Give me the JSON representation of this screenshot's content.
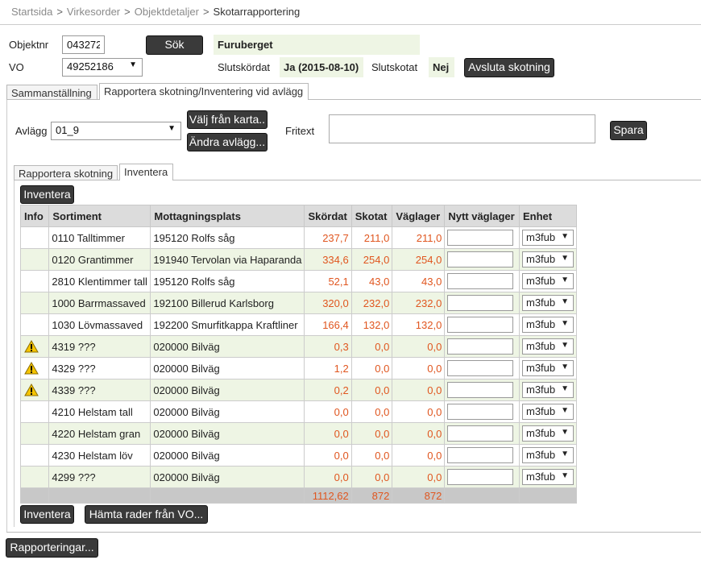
{
  "breadcrumb": {
    "items": [
      "Startsida",
      "Virkesorder",
      "Objektdetaljer"
    ],
    "sep": ">",
    "current": "Skotarrapportering"
  },
  "header": {
    "objektnr_label": "Objektnr",
    "objektnr_value": "043272",
    "search_button": "Sök",
    "object_name": "Furuberget",
    "vo_label": "VO",
    "vo_value": "49252186",
    "slutskordat_label": "Slutskördat",
    "slutskordat_value": "Ja (2015-08-10)",
    "slutskotat_label": "Slutskotat",
    "slutskotat_value": "Nej",
    "finish_button": "Avsluta skotning"
  },
  "tabs": {
    "main": [
      "Sammanställning",
      "Rapportera skotning/Inventering vid avlägg"
    ],
    "sub": [
      "Rapportera skotning",
      "Inventera"
    ]
  },
  "avlagg": {
    "label": "Avlägg",
    "value": "01_9",
    "map_button": "Välj från karta..",
    "change_button": "Ändra avlägg...",
    "fritext_label": "Fritext",
    "save_button": "Spara"
  },
  "inventera_button": "Inventera",
  "table": {
    "headers": [
      "Info",
      "Sortiment",
      "Mottagningsplats",
      "Skördat",
      "Skotat",
      "Väglager",
      "Nytt väglager",
      "Enhet"
    ],
    "rows": [
      {
        "warn": false,
        "sortiment": "0110 Talltimmer",
        "plats": "195120 Rolfs såg",
        "skordat": "237,7",
        "skotat": "211,0",
        "vaglager": "211,0",
        "enhet": "m3fub"
      },
      {
        "warn": false,
        "sortiment": "0120 Grantimmer",
        "plats": "191940 Tervolan via Haparanda",
        "skordat": "334,6",
        "skotat": "254,0",
        "vaglager": "254,0",
        "enhet": "m3fub"
      },
      {
        "warn": false,
        "sortiment": "2810 Klentimmer tall",
        "plats": "195120 Rolfs såg",
        "skordat": "52,1",
        "skotat": "43,0",
        "vaglager": "43,0",
        "enhet": "m3fub"
      },
      {
        "warn": false,
        "sortiment": "1000 Barrmassaved",
        "plats": "192100 Billerud Karlsborg",
        "skordat": "320,0",
        "skotat": "232,0",
        "vaglager": "232,0",
        "enhet": "m3fub"
      },
      {
        "warn": false,
        "sortiment": "1030 Lövmassaved",
        "plats": "192200 Smurfitkappa Kraftliner",
        "skordat": "166,4",
        "skotat": "132,0",
        "vaglager": "132,0",
        "enhet": "m3fub"
      },
      {
        "warn": true,
        "sortiment": "4319 ???",
        "plats": "020000 Bilväg",
        "skordat": "0,3",
        "skotat": "0,0",
        "vaglager": "0,0",
        "enhet": "m3fub"
      },
      {
        "warn": true,
        "sortiment": "4329 ???",
        "plats": "020000 Bilväg",
        "skordat": "1,2",
        "skotat": "0,0",
        "vaglager": "0,0",
        "enhet": "m3fub"
      },
      {
        "warn": true,
        "sortiment": "4339 ???",
        "plats": "020000 Bilväg",
        "skordat": "0,2",
        "skotat": "0,0",
        "vaglager": "0,0",
        "enhet": "m3fub"
      },
      {
        "warn": false,
        "sortiment": "4210 Helstam tall",
        "plats": "020000 Bilväg",
        "skordat": "0,0",
        "skotat": "0,0",
        "vaglager": "0,0",
        "enhet": "m3fub"
      },
      {
        "warn": false,
        "sortiment": "4220 Helstam gran",
        "plats": "020000 Bilväg",
        "skordat": "0,0",
        "skotat": "0,0",
        "vaglager": "0,0",
        "enhet": "m3fub"
      },
      {
        "warn": false,
        "sortiment": "4230 Helstam löv",
        "plats": "020000 Bilväg",
        "skordat": "0,0",
        "skotat": "0,0",
        "vaglager": "0,0",
        "enhet": "m3fub"
      },
      {
        "warn": false,
        "sortiment": "4299 ???",
        "plats": "020000 Bilväg",
        "skordat": "0,0",
        "skotat": "0,0",
        "vaglager": "0,0",
        "enhet": "m3fub"
      }
    ],
    "totals": {
      "skordat": "1112,62",
      "skotat": "872",
      "vaglager": "872"
    }
  },
  "bottom": {
    "inventera_button": "Inventera",
    "fetch_button": "Hämta rader från VO...",
    "reports_button": "Rapporteringar..."
  },
  "colors": {
    "accent_orange": "#e0561f",
    "row_green": "#eef5e4",
    "button_dark": "#3a3a3a"
  }
}
